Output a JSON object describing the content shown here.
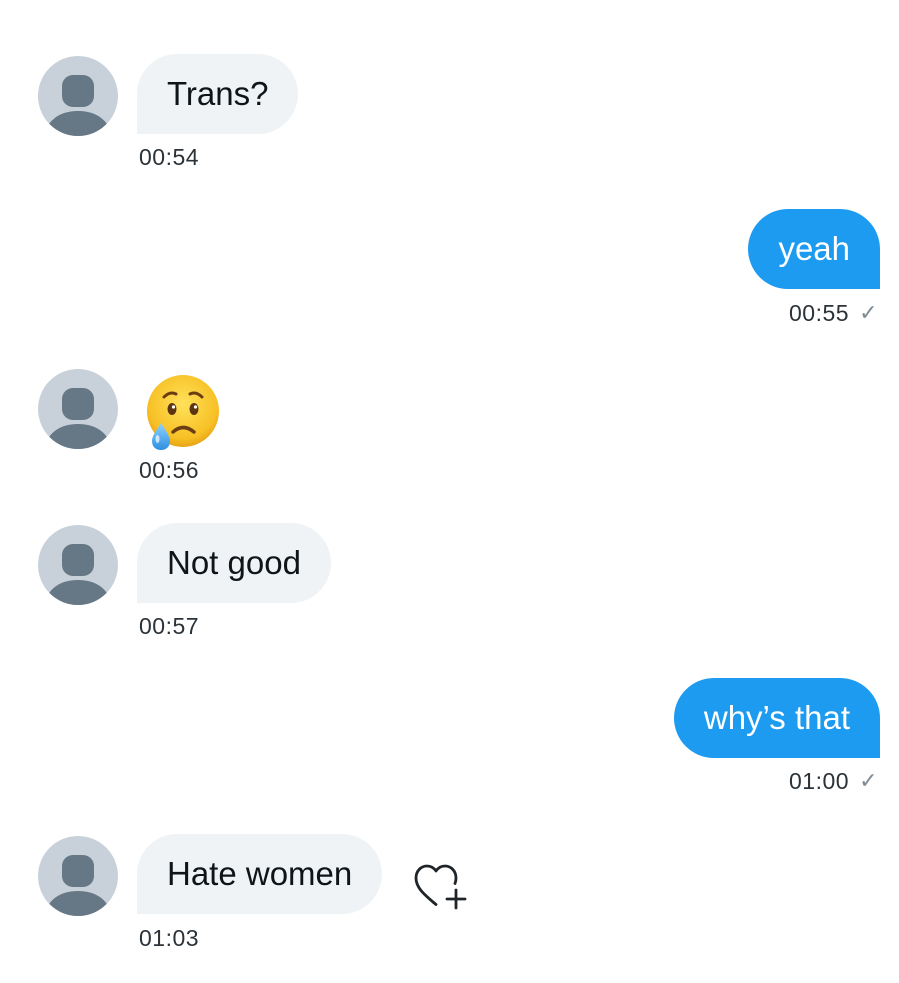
{
  "messages": [
    {
      "direction": "incoming",
      "kind": "text",
      "text": "Trans?",
      "time": "00:54"
    },
    {
      "direction": "outgoing",
      "kind": "text",
      "text": "yeah",
      "time": "00:55",
      "status_icon": "check-icon"
    },
    {
      "direction": "incoming",
      "kind": "emoji",
      "emoji_name": "crying-face-emoji",
      "time": "00:56"
    },
    {
      "direction": "incoming",
      "kind": "text",
      "text": "Not good",
      "time": "00:57"
    },
    {
      "direction": "outgoing",
      "kind": "text",
      "text": "why’s that",
      "time": "01:00",
      "status_icon": "check-icon"
    },
    {
      "direction": "incoming",
      "kind": "text",
      "text": "Hate women",
      "time": "01:03",
      "reaction_icon": "heart-add-icon"
    }
  ],
  "glyphs": {
    "check": "✓"
  },
  "colors": {
    "outgoing_bubble": "#1d9bf0",
    "incoming_bubble": "#eff3f5",
    "avatar_bg": "#c8d1d9",
    "avatar_fg": "#667786"
  }
}
